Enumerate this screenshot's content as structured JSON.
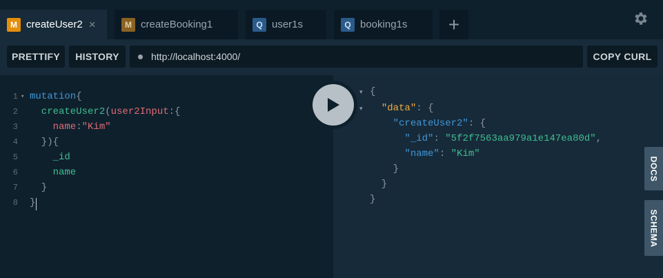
{
  "tabs": [
    {
      "badge": "M",
      "label": "createUser2",
      "close": "×"
    },
    {
      "badge": "M",
      "label": "createBooking1"
    },
    {
      "badge": "Q",
      "label": "user1s"
    },
    {
      "badge": "Q",
      "label": "booking1s"
    }
  ],
  "add_tab_label": "+",
  "toolbar": {
    "prettify": "PRETTIFY",
    "history": "HISTORY",
    "url": "http://localhost:4000/",
    "copy_curl": "COPY CURL"
  },
  "editor": {
    "line_numbers": [
      "1",
      "2",
      "3",
      "4",
      "5",
      "6",
      "7",
      "8"
    ],
    "lines": [
      {
        "parts": [
          {
            "t": "mutation",
            "c": "kw"
          },
          {
            "t": "{",
            "c": "pn"
          }
        ]
      },
      {
        "parts": [
          {
            "t": "  createUser2",
            "c": "fn"
          },
          {
            "t": "(",
            "c": "pn"
          },
          {
            "t": "user2Input",
            "c": "arg"
          },
          {
            "t": ":{",
            "c": "pn"
          }
        ]
      },
      {
        "parts": [
          {
            "t": "    name",
            "c": "arg"
          },
          {
            "t": ":",
            "c": "pn"
          },
          {
            "t": "\"Kim\"",
            "c": "str"
          }
        ]
      },
      {
        "parts": [
          {
            "t": "  }){",
            "c": "pn"
          }
        ]
      },
      {
        "parts": [
          {
            "t": "    _id",
            "c": "fld"
          }
        ]
      },
      {
        "parts": [
          {
            "t": "    name",
            "c": "fld"
          }
        ]
      },
      {
        "parts": [
          {
            "t": "  }",
            "c": "pn"
          }
        ]
      },
      {
        "parts": [
          {
            "t": "}",
            "c": "pn"
          }
        ]
      }
    ]
  },
  "result": {
    "lines": [
      {
        "parts": [
          {
            "t": "{",
            "c": "pn"
          }
        ]
      },
      {
        "parts": [
          {
            "t": "  ",
            "c": "pn"
          },
          {
            "t": "\"data\"",
            "c": "rkey-data"
          },
          {
            "t": ": {",
            "c": "pn"
          }
        ]
      },
      {
        "parts": [
          {
            "t": "    ",
            "c": "pn"
          },
          {
            "t": "\"createUser2\"",
            "c": "rkey"
          },
          {
            "t": ": {",
            "c": "pn"
          }
        ]
      },
      {
        "parts": [
          {
            "t": "      ",
            "c": "pn"
          },
          {
            "t": "\"_id\"",
            "c": "rkey"
          },
          {
            "t": ": ",
            "c": "pn"
          },
          {
            "t": "\"5f2f7563aa979a1e147ea80d\"",
            "c": "rstr"
          },
          {
            "t": ",",
            "c": "pn"
          }
        ]
      },
      {
        "parts": [
          {
            "t": "      ",
            "c": "pn"
          },
          {
            "t": "\"name\"",
            "c": "rkey"
          },
          {
            "t": ": ",
            "c": "pn"
          },
          {
            "t": "\"Kim\"",
            "c": "rstr"
          }
        ]
      },
      {
        "parts": [
          {
            "t": "    }",
            "c": "pn"
          }
        ]
      },
      {
        "parts": [
          {
            "t": "  }",
            "c": "pn"
          }
        ]
      },
      {
        "parts": [
          {
            "t": "}",
            "c": "pn"
          }
        ]
      }
    ]
  },
  "side": {
    "docs": "DOCS",
    "schema": "SCHEMA"
  },
  "icons": {
    "settings": "gear-icon",
    "run": "play-icon"
  }
}
